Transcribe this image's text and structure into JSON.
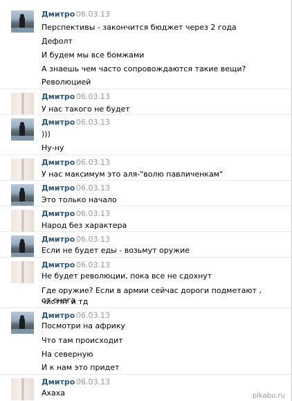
{
  "messages": [
    {
      "author": "Дмитро",
      "date": "06.03.13",
      "avatar": "photo",
      "lines": [
        "Перспективы - закончится бюджет через 2 года"
      ]
    },
    {
      "author": "",
      "date": "",
      "avatar": "",
      "lines": [
        "Дефолт"
      ]
    },
    {
      "author": "",
      "date": "",
      "avatar": "",
      "lines": [
        "И будем мы все бомжами"
      ]
    },
    {
      "author": "",
      "date": "",
      "avatar": "",
      "lines": [
        "А знаешь чем часто сопровождаются такие вещи?"
      ]
    },
    {
      "author": "",
      "date": "",
      "avatar": "",
      "lines": [
        "Революцией"
      ]
    },
    {
      "author": "Дмитро",
      "date": "06.03.13",
      "avatar": "paper",
      "lines": [
        "У нас такого не будет"
      ]
    },
    {
      "author": "Дмитро",
      "date": "06.03.13",
      "avatar": "photo",
      "lines": [
        ")))"
      ]
    },
    {
      "author": "",
      "date": "",
      "avatar": "",
      "lines": [
        "Ну-ну"
      ]
    },
    {
      "author": "Дмитро",
      "date": "06.03.13",
      "avatar": "paper",
      "lines": [
        "У нас максимум это аля-\"волю павличенкам\""
      ]
    },
    {
      "author": "Дмитро",
      "date": "06.03.13",
      "avatar": "photo",
      "lines": [
        "Это только начало"
      ]
    },
    {
      "author": "Дмитро",
      "date": "06.03.13",
      "avatar": "paper",
      "lines": [
        "Народ без характера"
      ]
    },
    {
      "author": "Дмитро",
      "date": "06.03.13",
      "avatar": "photo",
      "lines": [
        "Если не будет еды - возьмут оружие"
      ]
    },
    {
      "author": "Дмитро",
      "date": "06.03.13",
      "avatar": "paper",
      "lines": [
        "Не будет революции, пока все не сдохнут"
      ]
    },
    {
      "author": "",
      "date": "",
      "avatar": "",
      "lines": [
        "Где оружие? Если в армии сейчас дороги подметают , от снега",
        "чистят и тд"
      ]
    },
    {
      "author": "Дмитро",
      "date": "06.03.13",
      "avatar": "photo",
      "lines": [
        "Посмотри на африку"
      ]
    },
    {
      "author": "",
      "date": "",
      "avatar": "",
      "lines": [
        "Что там происходит"
      ]
    },
    {
      "author": "",
      "date": "",
      "avatar": "",
      "lines": [
        "На северную"
      ]
    },
    {
      "author": "",
      "date": "",
      "avatar": "",
      "lines": [
        "И к нам это придет"
      ]
    },
    {
      "author": "Дмитро",
      "date": "06.03.13",
      "avatar": "paper",
      "lines": [
        "Ахаха"
      ]
    }
  ],
  "watermark": "pikabu.ru"
}
